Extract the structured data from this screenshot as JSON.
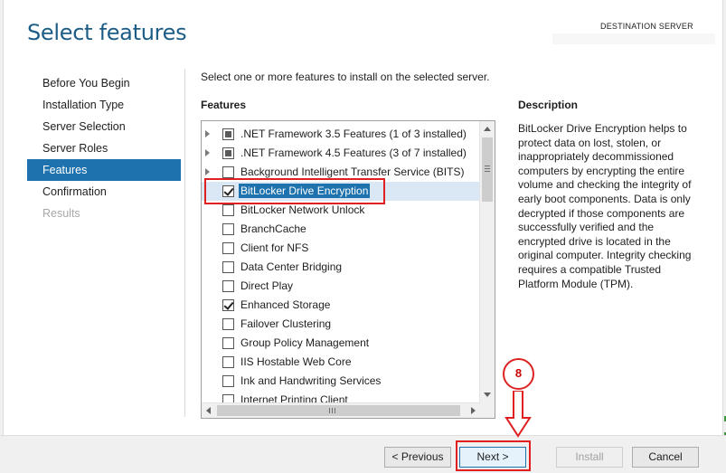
{
  "page": {
    "title": "Select features",
    "destination_label": "DESTINATION SERVER",
    "destination_value": ""
  },
  "nav": {
    "items": [
      {
        "label": "Before You Begin",
        "state": "normal"
      },
      {
        "label": "Installation Type",
        "state": "normal"
      },
      {
        "label": "Server Selection",
        "state": "normal"
      },
      {
        "label": "Server Roles",
        "state": "normal"
      },
      {
        "label": "Features",
        "state": "active"
      },
      {
        "label": "Confirmation",
        "state": "normal"
      },
      {
        "label": "Results",
        "state": "disabled"
      }
    ]
  },
  "main": {
    "instruction": "Select one or more features to install on the selected server.",
    "features_heading": "Features",
    "description_heading": "Description",
    "description_text": "BitLocker Drive Encryption helps to protect data on lost, stolen, or inappropriately decommissioned computers by encrypting the entire volume and checking the integrity of early boot components. Data is only decrypted if those components are successfully verified and the encrypted drive is located in the original computer. Integrity checking requires a compatible Trusted Platform Module (TPM).",
    "features": [
      {
        "label": ".NET Framework 3.5 Features (1 of 3 installed)",
        "state": "partial",
        "expandable": true,
        "selected": false
      },
      {
        "label": ".NET Framework 4.5 Features (3 of 7 installed)",
        "state": "partial",
        "expandable": true,
        "selected": false
      },
      {
        "label": "Background Intelligent Transfer Service (BITS)",
        "state": "unchecked",
        "expandable": true,
        "selected": false
      },
      {
        "label": "BitLocker Drive Encryption",
        "state": "checked",
        "expandable": false,
        "selected": true
      },
      {
        "label": "BitLocker Network Unlock",
        "state": "unchecked",
        "expandable": false,
        "selected": false
      },
      {
        "label": "BranchCache",
        "state": "unchecked",
        "expandable": false,
        "selected": false
      },
      {
        "label": "Client for NFS",
        "state": "unchecked",
        "expandable": false,
        "selected": false
      },
      {
        "label": "Data Center Bridging",
        "state": "unchecked",
        "expandable": false,
        "selected": false
      },
      {
        "label": "Direct Play",
        "state": "unchecked",
        "expandable": false,
        "selected": false
      },
      {
        "label": "Enhanced Storage",
        "state": "checked",
        "expandable": false,
        "selected": false
      },
      {
        "label": "Failover Clustering",
        "state": "unchecked",
        "expandable": false,
        "selected": false
      },
      {
        "label": "Group Policy Management",
        "state": "unchecked",
        "expandable": false,
        "selected": false
      },
      {
        "label": "IIS Hostable Web Core",
        "state": "unchecked",
        "expandable": false,
        "selected": false
      },
      {
        "label": "Ink and Handwriting Services",
        "state": "unchecked",
        "expandable": false,
        "selected": false
      },
      {
        "label": "Internet Printing Client",
        "state": "unchecked",
        "expandable": false,
        "selected": false
      }
    ]
  },
  "footer": {
    "previous_label": "< Previous",
    "next_label": "Next >",
    "install_label": "Install",
    "cancel_label": "Cancel"
  },
  "annotation": {
    "step_number": "8",
    "color": "#e02020"
  },
  "colors": {
    "title": "#1c5d87",
    "accent": "#1e72ad"
  }
}
